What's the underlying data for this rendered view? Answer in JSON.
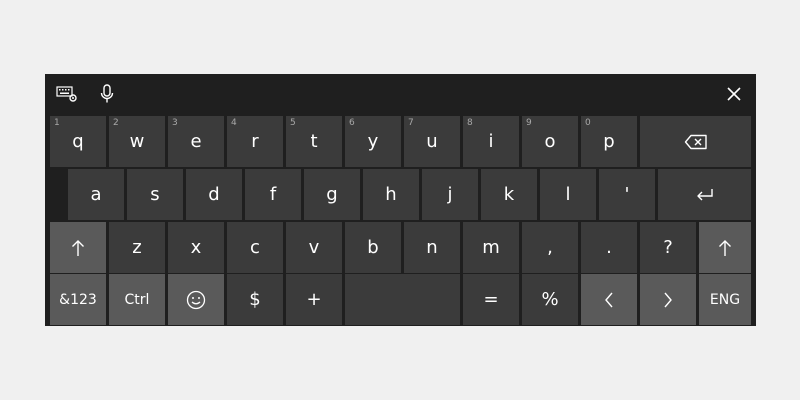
{
  "colors": {
    "background": "#f0f0f0",
    "keyboard_bg": "#1f1f1f",
    "key_bg": "#3b3b3b",
    "modifier_key_bg": "#5a5a5a",
    "text": "#ffffff",
    "number_hint": "#a8a8a8"
  },
  "toolbar": {
    "keyboard_settings_icon": "keyboard-settings-icon",
    "microphone_icon": "microphone-icon",
    "close_icon": "close-icon"
  },
  "row1": {
    "keys": [
      {
        "num": "1",
        "label": "q"
      },
      {
        "num": "2",
        "label": "w"
      },
      {
        "num": "3",
        "label": "e"
      },
      {
        "num": "4",
        "label": "r"
      },
      {
        "num": "5",
        "label": "t"
      },
      {
        "num": "6",
        "label": "y"
      },
      {
        "num": "7",
        "label": "u"
      },
      {
        "num": "8",
        "label": "i"
      },
      {
        "num": "9",
        "label": "o"
      },
      {
        "num": "0",
        "label": "p"
      }
    ],
    "backspace_icon": "backspace-icon"
  },
  "row2": {
    "keys": [
      "a",
      "s",
      "d",
      "f",
      "g",
      "h",
      "j",
      "k",
      "l",
      "'"
    ],
    "enter_icon": "enter-icon"
  },
  "row3": {
    "shift_left_icon": "shift-arrow-icon",
    "keys": [
      "z",
      "x",
      "c",
      "v",
      "b",
      "n",
      "m",
      ",",
      ".",
      "?"
    ],
    "shift_right_icon": "shift-arrow-icon"
  },
  "row4": {
    "symbols_label": "&123",
    "ctrl_label": "Ctrl",
    "emoji_icon": "emoji-smiley-icon",
    "dollar_label": "$",
    "plus_label": "+",
    "equals_label": "=",
    "percent_label": "%",
    "left_arrow_icon": "chevron-left-icon",
    "right_arrow_icon": "chevron-right-icon",
    "language_label": "ENG"
  }
}
